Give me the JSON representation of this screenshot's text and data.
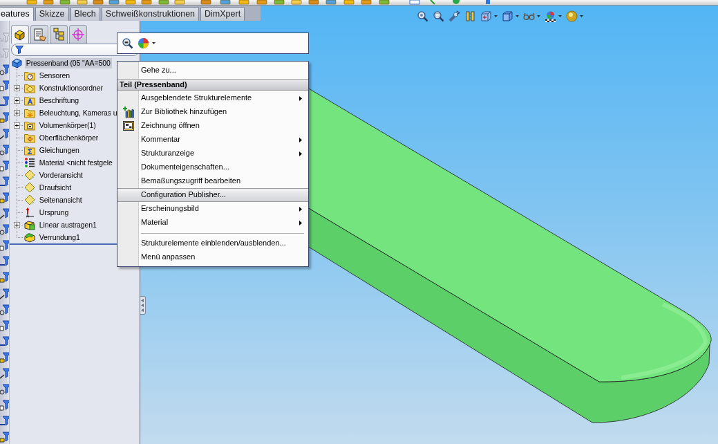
{
  "command_tabs": [
    {
      "label": "eatures",
      "selected": true
    },
    {
      "label": "Skizze",
      "selected": false
    },
    {
      "label": "Blech",
      "selected": false
    },
    {
      "label": "Schweißkonstruktionen",
      "selected": false
    },
    {
      "label": "DimXpert",
      "selected": false
    }
  ],
  "filter_toolbar": {
    "buttons": [
      {
        "disabled": true
      },
      {
        "disabled": true
      },
      {
        "disabled": false
      },
      {
        "disabled": false
      },
      {
        "disabled": false
      },
      {
        "disabled": false
      },
      {
        "disabled": false
      },
      {
        "disabled": false
      },
      {
        "disabled": false
      },
      {
        "disabled": false
      },
      {
        "disabled": false
      },
      {
        "disabled": false
      },
      {
        "disabled": false
      },
      {
        "disabled": false
      },
      {
        "disabled": false
      },
      {
        "disabled": false
      },
      {
        "disabled": false
      },
      {
        "disabled": false
      },
      {
        "disabled": false
      },
      {
        "disabled": false
      },
      {
        "disabled": false
      },
      {
        "disabled": false
      },
      {
        "disabled": false
      },
      {
        "disabled": false
      },
      {
        "disabled": false
      },
      {
        "disabled": false
      }
    ]
  },
  "panel_tabs": [
    {
      "kind": "features",
      "selected": true
    },
    {
      "kind": "properties",
      "selected": false
    },
    {
      "kind": "configurations",
      "selected": false
    },
    {
      "kind": "dimxpert",
      "selected": false
    }
  ],
  "feature_tree": {
    "root": {
      "label": "Pressenband (05 \"AA=500",
      "kind": "part",
      "selected": true,
      "children": [
        {
          "label": "Sensoren",
          "kind": "sensors",
          "expandable": false,
          "selected": false
        },
        {
          "label": "Konstruktionsordner",
          "kind": "folder",
          "expandable": true,
          "selected": false
        },
        {
          "label": "Beschriftung",
          "kind": "annotations",
          "expandable": true,
          "selected": false
        },
        {
          "label": "Beleuchtung, Kameras u",
          "kind": "lights",
          "expandable": true,
          "selected": false
        },
        {
          "label": "Volumenkörper(1)",
          "kind": "bodies",
          "expandable": true,
          "selected": false
        },
        {
          "label": "Oberflächenkörper",
          "kind": "surfaces",
          "expandable": false,
          "selected": false
        },
        {
          "label": "Gleichungen",
          "kind": "equations",
          "expandable": false,
          "selected": false
        },
        {
          "label": "Material <nicht festgele",
          "kind": "material",
          "expandable": false,
          "selected": false
        },
        {
          "label": "Vorderansicht",
          "kind": "plane",
          "expandable": false,
          "selected": false
        },
        {
          "label": "Draufsicht",
          "kind": "plane",
          "expandable": false,
          "selected": false
        },
        {
          "label": "Seitenansicht",
          "kind": "plane",
          "expandable": false,
          "selected": false
        },
        {
          "label": "Ursprung",
          "kind": "origin",
          "expandable": false,
          "selected": false
        },
        {
          "label": "Linear austragen1",
          "kind": "extrude",
          "expandable": true,
          "selected": false
        },
        {
          "label": "Verrundung1",
          "kind": "fillet",
          "expandable": false,
          "selected": false
        }
      ]
    }
  },
  "context_menu": {
    "items": [
      {
        "kind": "plain",
        "label": "Gehe zu...",
        "submenu": false,
        "selected": false
      },
      {
        "kind": "header",
        "label": "Teil (Pressenband)"
      },
      {
        "kind": "plain",
        "label": "Ausgeblendete Strukturelemente",
        "submenu": true,
        "selected": false
      },
      {
        "kind": "library",
        "label": "Zur Bibliothek hinzufügen",
        "submenu": false,
        "selected": false
      },
      {
        "kind": "drawing",
        "label": "Zeichnung öffnen",
        "submenu": false,
        "selected": false
      },
      {
        "kind": "plain",
        "label": "Kommentar",
        "submenu": true,
        "selected": false
      },
      {
        "kind": "plain",
        "label": "Strukturanzeige",
        "submenu": true,
        "selected": false
      },
      {
        "kind": "plain",
        "label": "Dokumenteigenschaften...",
        "submenu": false,
        "selected": false
      },
      {
        "kind": "plain",
        "label": "Bemaßungszugriff bearbeiten",
        "submenu": false,
        "selected": false
      },
      {
        "kind": "plain",
        "label": "Configuration Publisher...",
        "submenu": false,
        "selected": true
      },
      {
        "kind": "plain",
        "label": "Erscheinungsbild",
        "submenu": true,
        "selected": false
      },
      {
        "kind": "plain",
        "label": "Material",
        "submenu": true,
        "selected": false
      },
      {
        "kind": "separator"
      },
      {
        "kind": "plain",
        "label": "Strukturelemente einblenden/ausblenden...",
        "submenu": false,
        "selected": false
      },
      {
        "kind": "plain",
        "label": "Menü anpassen",
        "submenu": false,
        "selected": false
      }
    ]
  }
}
